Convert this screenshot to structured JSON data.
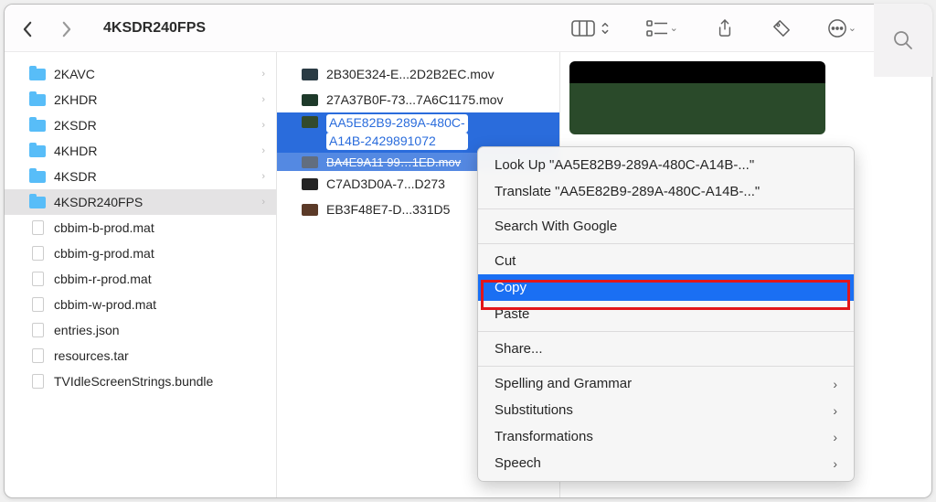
{
  "toolbar": {
    "title": "4KSDR240FPS"
  },
  "sidebar": {
    "items": [
      {
        "label": "2KAVC",
        "type": "folder"
      },
      {
        "label": "2KHDR",
        "type": "folder"
      },
      {
        "label": "2KSDR",
        "type": "folder"
      },
      {
        "label": "4KHDR",
        "type": "folder"
      },
      {
        "label": "4KSDR",
        "type": "folder"
      },
      {
        "label": "4KSDR240FPS",
        "type": "folder",
        "selected": true
      },
      {
        "label": "cbbim-b-prod.mat",
        "type": "file"
      },
      {
        "label": "cbbim-g-prod.mat",
        "type": "file"
      },
      {
        "label": "cbbim-r-prod.mat",
        "type": "file"
      },
      {
        "label": "cbbim-w-prod.mat",
        "type": "file"
      },
      {
        "label": "entries.json",
        "type": "file"
      },
      {
        "label": "resources.tar",
        "type": "file"
      },
      {
        "label": "TVIdleScreenStrings.bundle",
        "type": "bundle"
      }
    ]
  },
  "files": {
    "items": [
      {
        "label": "2B30E324-E...2D2B2EC.mov",
        "thumb": "#2a3b44"
      },
      {
        "label": "27A37B0F-73...7A6C1175.mov",
        "thumb": "#1e3a2a"
      },
      {
        "label_line1": "AA5E82B9-289A-480C-",
        "label_line2": "A14B-2429891072",
        "selected": true,
        "thumb": "#334a2c"
      },
      {
        "label": "BA4E9A11 99…1ED.mov",
        "thumb": "#3c4a60",
        "ghost": true
      },
      {
        "label": "C7AD3D0A-7...D273",
        "thumb": "#242424"
      },
      {
        "label": "EB3F48E7-D...331D5",
        "thumb": "#5b3a28"
      }
    ]
  },
  "context_menu": {
    "lookup": "Look Up \"AA5E82B9-289A-480C-A14B-...\"",
    "translate": "Translate \"AA5E82B9-289A-480C-A14B-...\"",
    "search": "Search With Google",
    "cut": "Cut",
    "copy": "Copy",
    "paste": "Paste",
    "share": "Share...",
    "spelling": "Spelling and Grammar",
    "substitutions": "Substitutions",
    "transformations": "Transformations",
    "speech": "Speech"
  }
}
